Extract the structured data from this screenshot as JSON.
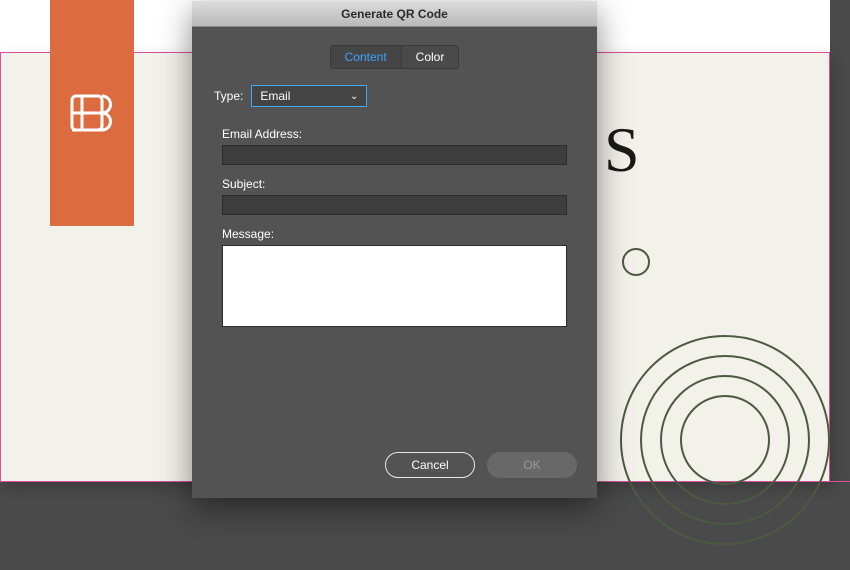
{
  "dialog": {
    "title": "Generate QR Code",
    "tabs": {
      "content": "Content",
      "color": "Color"
    },
    "type_label": "Type:",
    "type_value": "Email",
    "fields": {
      "email_label": "Email Address:",
      "email_value": "",
      "subject_label": "Subject:",
      "subject_value": "",
      "message_label": "Message:",
      "message_value": ""
    },
    "buttons": {
      "cancel": "Cancel",
      "ok": "OK"
    }
  },
  "bg": {
    "letter": "S"
  }
}
